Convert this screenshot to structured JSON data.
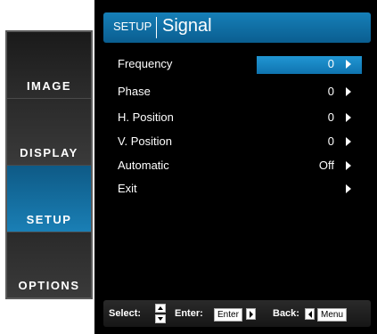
{
  "tabs": [
    {
      "label": "IMAGE"
    },
    {
      "label": "DISPLAY"
    },
    {
      "label": "SETUP"
    },
    {
      "label": "OPTIONS"
    }
  ],
  "header": {
    "section": "SETUP",
    "title": "Signal"
  },
  "menu": [
    {
      "name": "Frequency",
      "value": "0"
    },
    {
      "name": "Phase",
      "value": "0"
    },
    {
      "name": "H. Position",
      "value": "0"
    },
    {
      "name": "V. Position",
      "value": "0"
    },
    {
      "name": "Automatic",
      "value": "Off"
    },
    {
      "name": "Exit",
      "value": ""
    }
  ],
  "help": {
    "select_label": "Select:",
    "enter_label": "Enter:",
    "enter_key": "Enter",
    "back_label": "Back:",
    "menu_key": "Menu"
  },
  "colors": {
    "accent": "#1a7fb5",
    "highlight": "#2196d3"
  }
}
